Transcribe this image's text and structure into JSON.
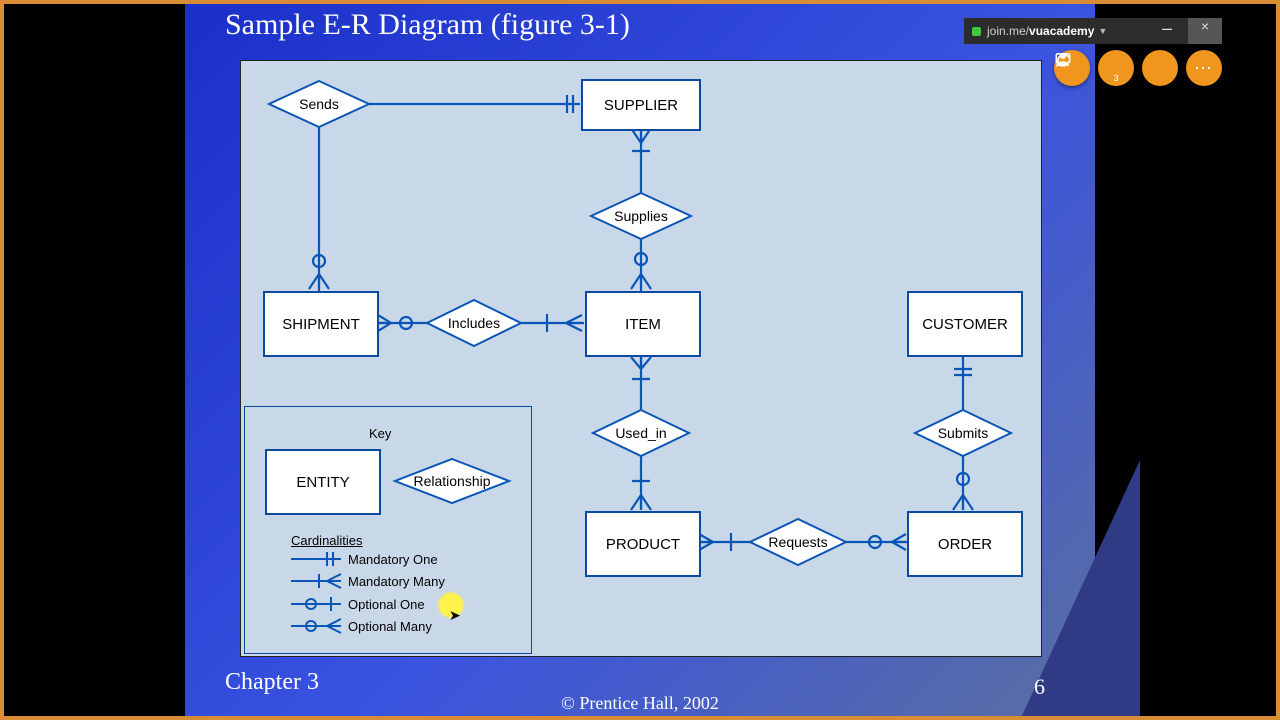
{
  "slide": {
    "title": "Sample E-R Diagram (figure 3-1)",
    "chapter": "Chapter 3",
    "copyright": "© Prentice Hall, 2002",
    "pageNumber": "6"
  },
  "entities": {
    "supplier": "SUPPLIER",
    "shipment": "SHIPMENT",
    "item": "ITEM",
    "customer": "CUSTOMER",
    "product": "PRODUCT",
    "order": "ORDER"
  },
  "relationships": {
    "sends": "Sends",
    "supplies": "Supplies",
    "includes": "Includes",
    "used_in": "Used_in",
    "submits": "Submits",
    "requests": "Requests"
  },
  "key": {
    "heading": "Key",
    "entity": "ENTITY",
    "relationship": "Relationship",
    "cardinalitiesHeading": "Cardinalities",
    "items": {
      "mandatoryOne": "Mandatory One",
      "mandatoryMany": "Mandatory Many",
      "optionalOne": "Optional One",
      "optionalMany": "Optional Many"
    }
  },
  "joinme": {
    "prefix": "join.me/",
    "room": "vuacademy"
  },
  "colors": {
    "line": "#0a55b8",
    "entBorder": "#0a4aa0",
    "slideBlue": "#1a2fc9",
    "orange": "#f0951e",
    "frame": "#d98c36"
  }
}
